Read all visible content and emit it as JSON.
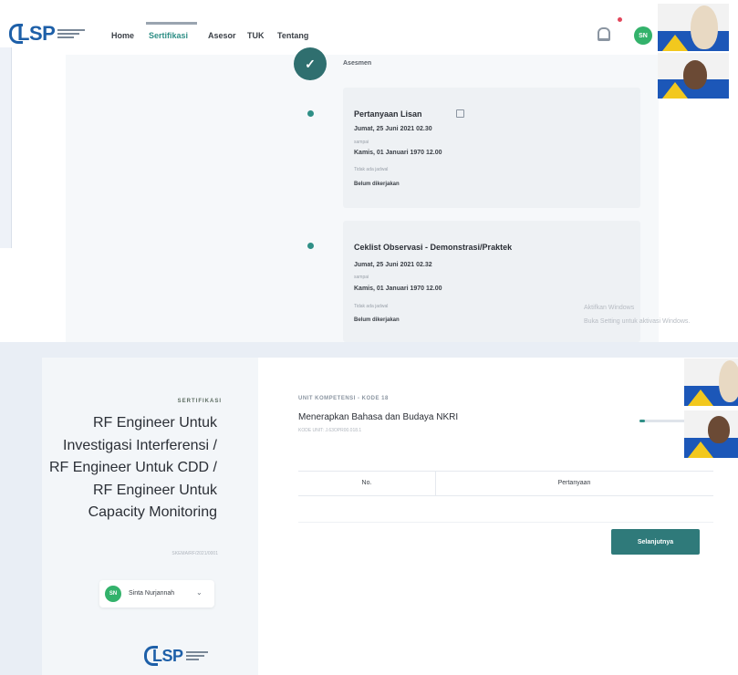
{
  "top_app": {
    "logo_text": "LSP",
    "nav": [
      {
        "label": "Home"
      },
      {
        "label": "Sertifikasi"
      },
      {
        "label": "Asesor"
      },
      {
        "label": "TUK"
      },
      {
        "label": "Tentang"
      }
    ],
    "user_initials": "SN"
  },
  "timeline": {
    "step_icon": "✓",
    "step_label": "Asesmen",
    "items": [
      {
        "title": "Pertanyaan Lisan",
        "start": "Jumat, 25 Juni 2021 02.30",
        "start_caption": "sampai",
        "end": "Kamis, 01 Januari 1970 12.00",
        "end_caption": "Tidak ada jadwal",
        "status": "Belum dikerjakan"
      },
      {
        "title": "Ceklist Observasi - Demonstrasi/Praktek",
        "start": "Jumat, 25 Juni 2021 02.32",
        "start_caption": "sampai",
        "end": "Kamis, 01 Januari 1970 12.00",
        "end_caption": "Tidak ada jadwal",
        "status": "Belum dikerjakan"
      }
    ]
  },
  "watermark": {
    "line1": "Aktifkan Windows",
    "line2": "Buka Setting untuk aktivasi Windows."
  },
  "bottom_app": {
    "section_label": "SERTIFIKASI",
    "cert_title": "RF Engineer Untuk Investigasi Interferensi / RF Engineer Untuk CDD / RF Engineer Untuk Capacity Monitoring",
    "cert_code": "SKEMA/RF/2021/0001",
    "user_name": "Sinta Nurjannah",
    "user_initials": "SN",
    "chevron": "⌄",
    "logo_text": "LSP",
    "unit_label": "UNIT KOMPETENSI - KODE 18",
    "unit_title": "Menerapkan Bahasa dan Budaya NKRI",
    "unit_code": "KODE UNIT: J.63OPR00.018.1",
    "progress": 0.08,
    "table_headers": [
      "No.",
      "Pertanyaan"
    ],
    "next_button": "Selanjutnya"
  },
  "icons": {
    "bell": "bell-icon",
    "edit": "edit-icon",
    "check": "check-icon",
    "chevron": "chevron-down-icon"
  },
  "colors": {
    "accent": "#2f8f86",
    "button": "#2f7a7a",
    "logo": "#1d5fa8",
    "avatar": "#33b26b",
    "notification": "#e2465b"
  }
}
